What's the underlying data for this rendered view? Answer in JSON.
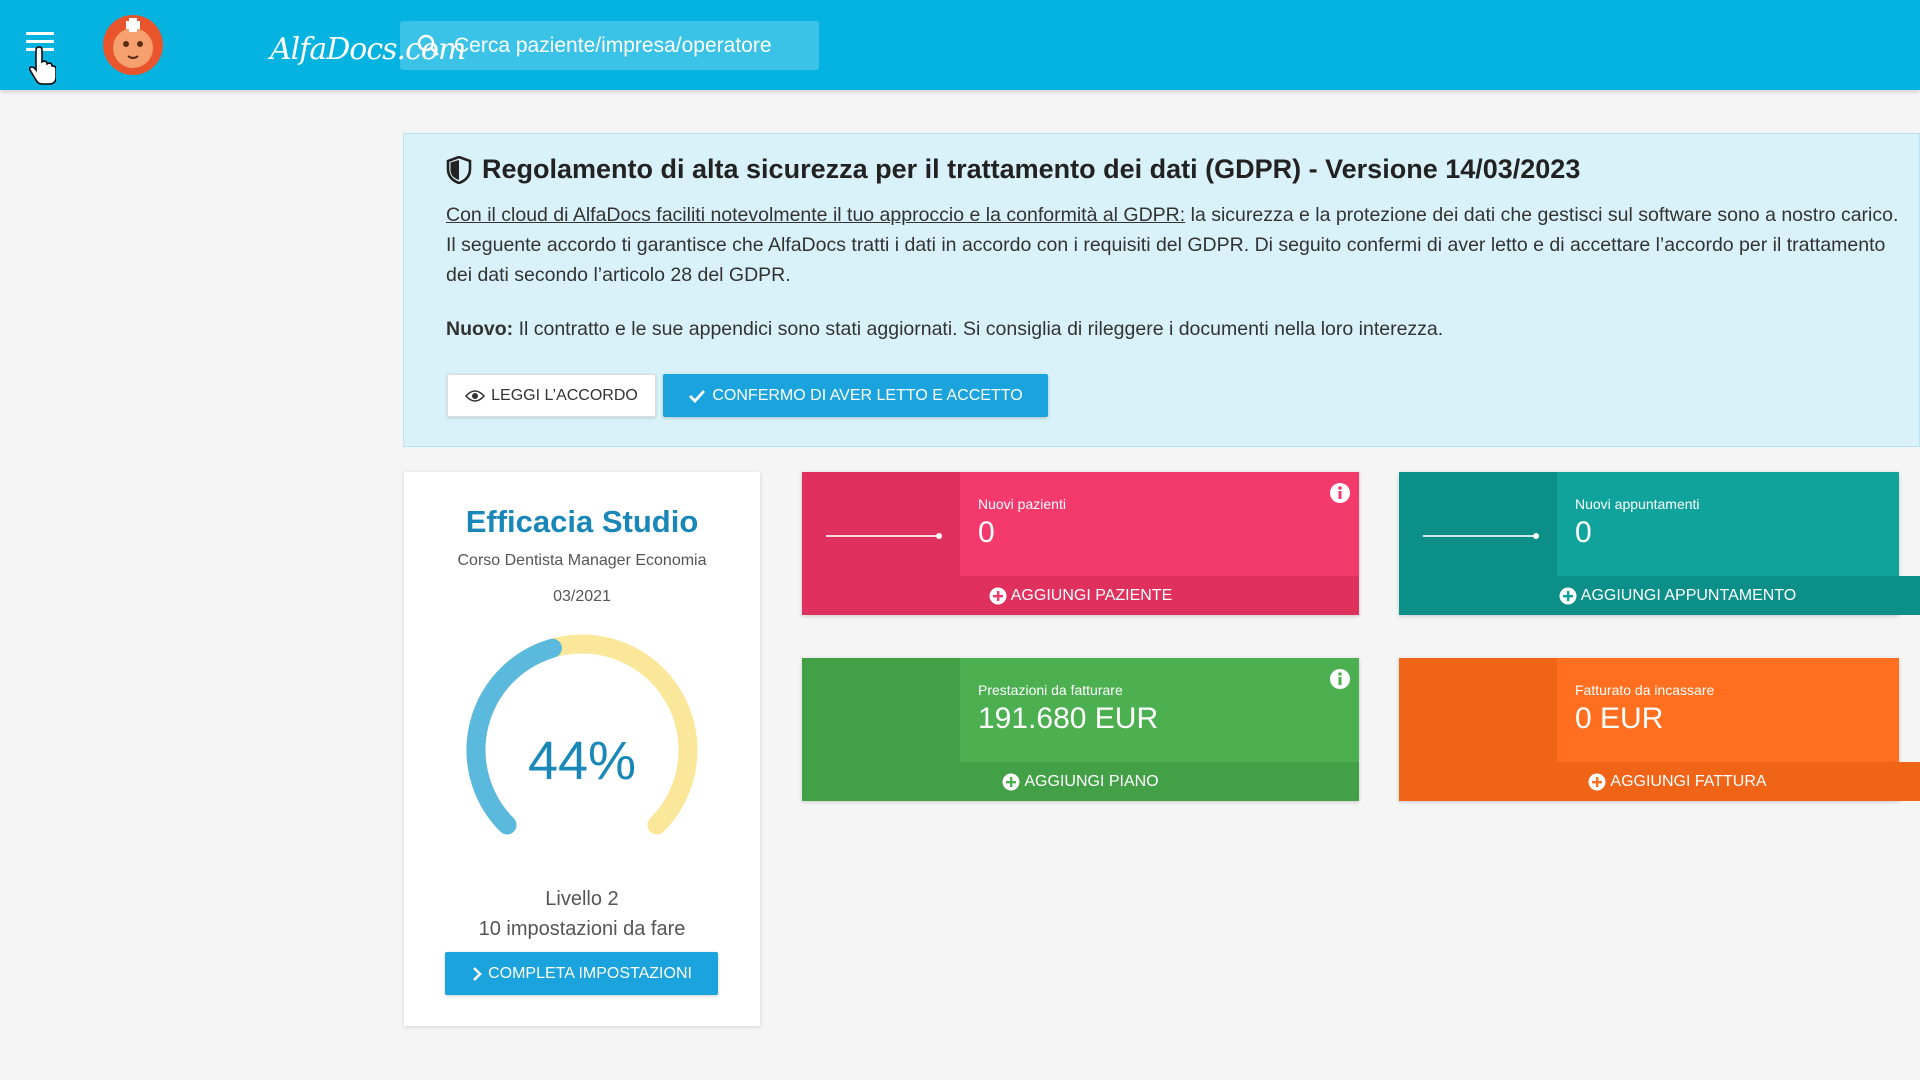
{
  "topbar": {
    "brand": "AlfaDocs.com",
    "search_placeholder": "Cerca paziente/impresa/operatore",
    "color": "#05b3e1"
  },
  "gdpr": {
    "title": "Regolamento di alta sicurezza per il trattamento dei dati (GDPR) - Versione 14/03/2023",
    "link_text": "Con il cloud di AlfaDocs faciliti notevolmente il tuo approccio e la conformità al GDPR:",
    "body_text": " la sicurezza e la protezione dei dati che gestisci sul software sono a nostro carico. Il seguente accordo ti garantisce che AlfaDocs tratti i dati in accordo con i requisiti del GDPR. Di seguito confermi di aver letto e di accettare l’accordo per il trattamento dei dati secondo l’articolo 28 del GDPR.",
    "new_label": "Nuovo:",
    "new_text": " Il contratto e le sue appendici sono stati aggiornati. Si consiglia di rileggere i documenti nella loro interezza.",
    "read_button": "LEGGI L’ACCORDO",
    "confirm_button": "CONFERMO DI AVER LETTO E ACCETTO"
  },
  "efficacia": {
    "title": "Efficacia Studio",
    "subtitle": "Corso Dentista Manager Economia",
    "date": "03/2021",
    "percent_label": "44%",
    "progress": 0.44,
    "level": "Livello 2",
    "todo": "10 impostazioni da fare",
    "button": "COMPLETA IMPOSTAZIONI"
  },
  "stats": [
    {
      "label": "Nuovi pazienti",
      "value": "0",
      "action": "AGGIUNGI PAZIENTE",
      "color": "#f43a6c",
      "color_dark": "#e0305e",
      "info": true
    },
    {
      "label": "Nuovi appuntamenti",
      "value": "0",
      "action": "AGGIUNGI APPUNTAMENTO",
      "color": "#0fa39c",
      "color_dark": "#0c8f89",
      "info": false
    },
    {
      "label": "Prestazioni da fatturare",
      "value": "191.680 EUR",
      "action": "AGGIUNGI PIANO",
      "color": "#4caf50",
      "color_dark": "#44a047",
      "info": true
    },
    {
      "label": "Fatturato da incassare",
      "value": "0 EUR",
      "action": "AGGIUNGI FATTURA",
      "color": "#ff6f1f",
      "color_dark": "#f06418",
      "info": false
    }
  ]
}
